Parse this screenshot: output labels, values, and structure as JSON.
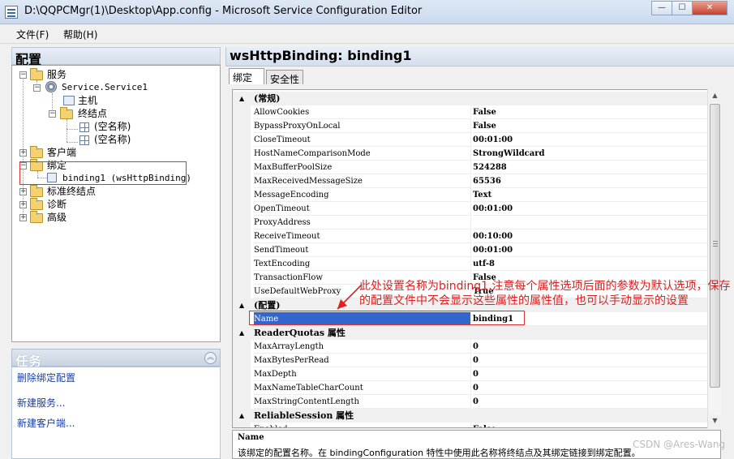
{
  "window": {
    "title": "D:\\QQPCMgr(1)\\Desktop\\App.config - Microsoft Service Configuration Editor",
    "minimize": "—",
    "maximize": "☐",
    "close": "✕"
  },
  "menu": [
    "文件(F)",
    "帮助(H)"
  ],
  "left": {
    "header": "配置",
    "tree": [
      {
        "label": "服务",
        "expander": "−"
      },
      {
        "label": "Service.Service1",
        "expander": "−"
      },
      {
        "label": "主机",
        "expander": ""
      },
      {
        "label": "终结点",
        "expander": "−"
      },
      {
        "label": "(空名称)",
        "expander": ""
      },
      {
        "label": "(空名称)",
        "expander": ""
      },
      {
        "label": "客户端",
        "expander": "+"
      },
      {
        "label": "绑定",
        "expander": "−"
      },
      {
        "label": "binding1 (wsHttpBinding)",
        "expander": ""
      },
      {
        "label": "标准终结点",
        "expander": "+"
      },
      {
        "label": "诊断",
        "expander": "+"
      },
      {
        "label": "高级",
        "expander": "+"
      }
    ]
  },
  "tasks": {
    "header": "任务",
    "toggle": "︽",
    "links": [
      "删除绑定配置",
      "新建服务...",
      "新建客户端..."
    ]
  },
  "right": {
    "header": "wsHttpBinding: binding1",
    "tabs": [
      "绑定",
      "安全性"
    ],
    "rows": [
      {
        "type": "cat",
        "name": "(常规)",
        "arrow": "▲"
      },
      {
        "type": "prop",
        "name": "AllowCookies",
        "value": "False"
      },
      {
        "type": "prop",
        "name": "BypassProxyOnLocal",
        "value": "False"
      },
      {
        "type": "prop",
        "name": "CloseTimeout",
        "value": "00:01:00"
      },
      {
        "type": "prop",
        "name": "HostNameComparisonMode",
        "value": "StrongWildcard"
      },
      {
        "type": "prop",
        "name": "MaxBufferPoolSize",
        "value": "524288"
      },
      {
        "type": "prop",
        "name": "MaxReceivedMessageSize",
        "value": "65536"
      },
      {
        "type": "prop",
        "name": "MessageEncoding",
        "value": "Text"
      },
      {
        "type": "prop",
        "name": "OpenTimeout",
        "value": "00:01:00"
      },
      {
        "type": "prop",
        "name": "ProxyAddress",
        "value": ""
      },
      {
        "type": "prop",
        "name": "ReceiveTimeout",
        "value": "00:10:00"
      },
      {
        "type": "prop",
        "name": "SendTimeout",
        "value": "00:01:00"
      },
      {
        "type": "prop",
        "name": "TextEncoding",
        "value": "utf-8"
      },
      {
        "type": "prop",
        "name": "TransactionFlow",
        "value": "False"
      },
      {
        "type": "prop",
        "name": "UseDefaultWebProxy",
        "value": "True"
      },
      {
        "type": "cat",
        "name": "(配置)",
        "arrow": "▲"
      },
      {
        "type": "prop",
        "name": "Name",
        "value": "binding1",
        "selected": true
      },
      {
        "type": "cat",
        "name": "ReaderQuotas 属性",
        "arrow": "▲"
      },
      {
        "type": "prop",
        "name": "MaxArrayLength",
        "value": "0"
      },
      {
        "type": "prop",
        "name": "MaxBytesPerRead",
        "value": "0"
      },
      {
        "type": "prop",
        "name": "MaxDepth",
        "value": "0"
      },
      {
        "type": "prop",
        "name": "MaxNameTableCharCount",
        "value": "0"
      },
      {
        "type": "prop",
        "name": "MaxStringContentLength",
        "value": "0"
      },
      {
        "type": "cat",
        "name": "ReliableSession 属性",
        "arrow": "▲"
      },
      {
        "type": "prop",
        "name": "Enabled",
        "value": "False"
      }
    ],
    "scroll_up": "▲",
    "scroll_down": "▼",
    "description": {
      "title": "Name",
      "text": "该绑定的配置名称。在 bindingConfiguration 特性中使用此名称将终结点及其绑定链接到绑定配置。"
    }
  },
  "annotation": "此处设置名称为binding1,注意每个属性选项后面的参数为默认选项，保存的配置文件中不会显示这些属性的属性值，也可以手动显示的设置",
  "watermark": "CSDN @Ares-Wang",
  "colors": {
    "annotation": "#e02020",
    "selection": "#3366cc"
  }
}
